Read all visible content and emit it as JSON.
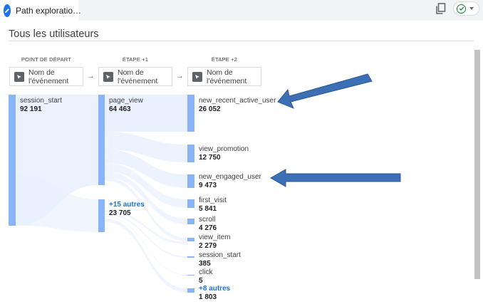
{
  "tab": {
    "title": "Path exploratio…",
    "icon": "pencil-icon"
  },
  "toolbar": {
    "copy_icon": "copy-icon",
    "status_icon": "check-circle-icon"
  },
  "section": {
    "title": "Tous les utilisateurs"
  },
  "steps": [
    {
      "label": "POINT DE DÉPART",
      "node_type": "Nom de\nl'événement"
    },
    {
      "label": "ÉTAPE +1",
      "node_type": "Nom de\nl'événement"
    },
    {
      "label": "ÉTAPE +2",
      "node_type": "Nom de\nl'événement"
    }
  ],
  "start_nodes": [
    {
      "name": "session_start",
      "value": "92 191"
    }
  ],
  "step1_nodes": [
    {
      "name": "page_view",
      "value": "64 463"
    },
    {
      "name": "+15 autres",
      "value": "23 705"
    }
  ],
  "step2_nodes": [
    {
      "name": "new_recent_active_user",
      "value": "26 052"
    },
    {
      "name": "view_promotion",
      "value": "12 750"
    },
    {
      "name": "new_engaged_user",
      "value": "9 473"
    },
    {
      "name": "first_visit",
      "value": "5 841"
    },
    {
      "name": "scroll",
      "value": "4 276"
    },
    {
      "name": "view_item",
      "value": "2 279"
    },
    {
      "name": "session_start",
      "value": "385"
    },
    {
      "name": "click",
      "value": "5"
    },
    {
      "name": "+8 autres",
      "value": "1 803"
    }
  ],
  "colors": {
    "node_bar": "#8ab4f8",
    "flow": "#e8f0fe",
    "link": "#1a73e8",
    "annotation_arrow": "#3c6fb4"
  }
}
